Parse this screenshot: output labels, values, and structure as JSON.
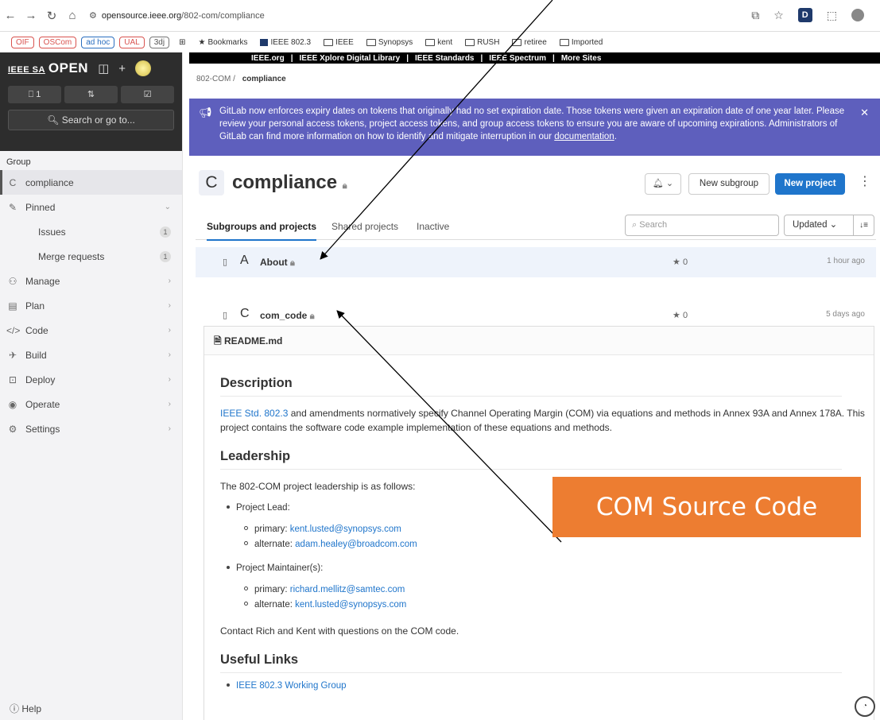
{
  "browser": {
    "url_host": "opensource.ieee.org",
    "url_path": "/802-com/compliance",
    "bookmark_chips": [
      "OIF",
      "OSCom",
      "ad hoc",
      "UAL",
      "3dj"
    ],
    "bookmarks": [
      "Bookmarks",
      "IEEE 802.3",
      "IEEE",
      "Synopsys",
      "kent",
      "RUSH",
      "retiree",
      "Imported"
    ]
  },
  "ieee_bar": [
    "IEEE.org",
    "IEEE Xplore Digital Library",
    "IEEE Standards",
    "IEEE Spectrum",
    "More Sites"
  ],
  "sidebar": {
    "logo_small": "IEEE SA",
    "logo_big": "OPEN",
    "counts": [
      "1",
      "",
      ""
    ],
    "search_label": "Search or go to...",
    "group_label": "Group",
    "items": [
      {
        "label": "compliance",
        "icon": "C"
      },
      {
        "label": "Pinned",
        "icon": "pin"
      },
      {
        "label": "Issues",
        "badge": "1"
      },
      {
        "label": "Merge requests",
        "badge": "1"
      },
      {
        "label": "Manage",
        "icon": "manage"
      },
      {
        "label": "Plan",
        "icon": "plan"
      },
      {
        "label": "Code",
        "icon": "code"
      },
      {
        "label": "Build",
        "icon": "build"
      },
      {
        "label": "Deploy",
        "icon": "deploy"
      },
      {
        "label": "Operate",
        "icon": "operate"
      },
      {
        "label": "Settings",
        "icon": "settings"
      }
    ],
    "help": "Help"
  },
  "breadcrumb": {
    "root": "802-COM",
    "current": "compliance"
  },
  "banner": {
    "text": "GitLab now enforces expiry dates on tokens that originally had no set expiration date. Those tokens were given an expiration date of one year later. Please review your personal access tokens, project access tokens, and group access tokens to ensure you are aware of upcoming expirations. Administrators of GitLab can find more information on how to identify and mitigate interruption in our ",
    "link": "documentation",
    "end": "."
  },
  "group": {
    "letter": "C",
    "title": "compliance",
    "new_subgroup": "New subgroup",
    "new_project": "New project"
  },
  "tabs": [
    "Subgroups and projects",
    "Shared projects",
    "Inactive"
  ],
  "search_placeholder": "Search",
  "sort_label": "Updated",
  "projects": [
    {
      "letter": "A",
      "name": "About",
      "stars": "0",
      "updated": "1 hour ago"
    },
    {
      "letter": "C",
      "name": "com_code",
      "stars": "0",
      "updated": "5 days ago"
    }
  ],
  "readme": {
    "filename": "README.md",
    "h_description": "Description",
    "desc_link": "IEEE Std. 802.3",
    "desc_text": " and amendments normatively specify Channel Operating Margin (COM) via equations and methods in Annex 93A and Annex 178A. This project contains the software code example implementation of these equations and methods.",
    "h_leadership": "Leadership",
    "leadership_intro": "The 802-COM project leadership is as follows:",
    "lead_label": "Project Lead:",
    "lead_primary_label": "primary: ",
    "lead_primary": "kent.lusted@synopsys.com",
    "lead_alternate_label": "alternate: ",
    "lead_alternate": "adam.healey@broadcom.com",
    "maint_label": "Project Maintainer(s):",
    "maint_primary_label": "primary: ",
    "maint_primary": "richard.mellitz@samtec.com",
    "maint_alternate_label": "alternate: ",
    "maint_alternate": "kent.lusted@synopsys.com",
    "contact": "Contact Rich and Kent with questions on the COM code.",
    "h_links": "Useful Links",
    "link_1": "IEEE 802.3 Working Group"
  },
  "annotation": {
    "label": "COM Source Code",
    "color": "#ed7d31"
  }
}
